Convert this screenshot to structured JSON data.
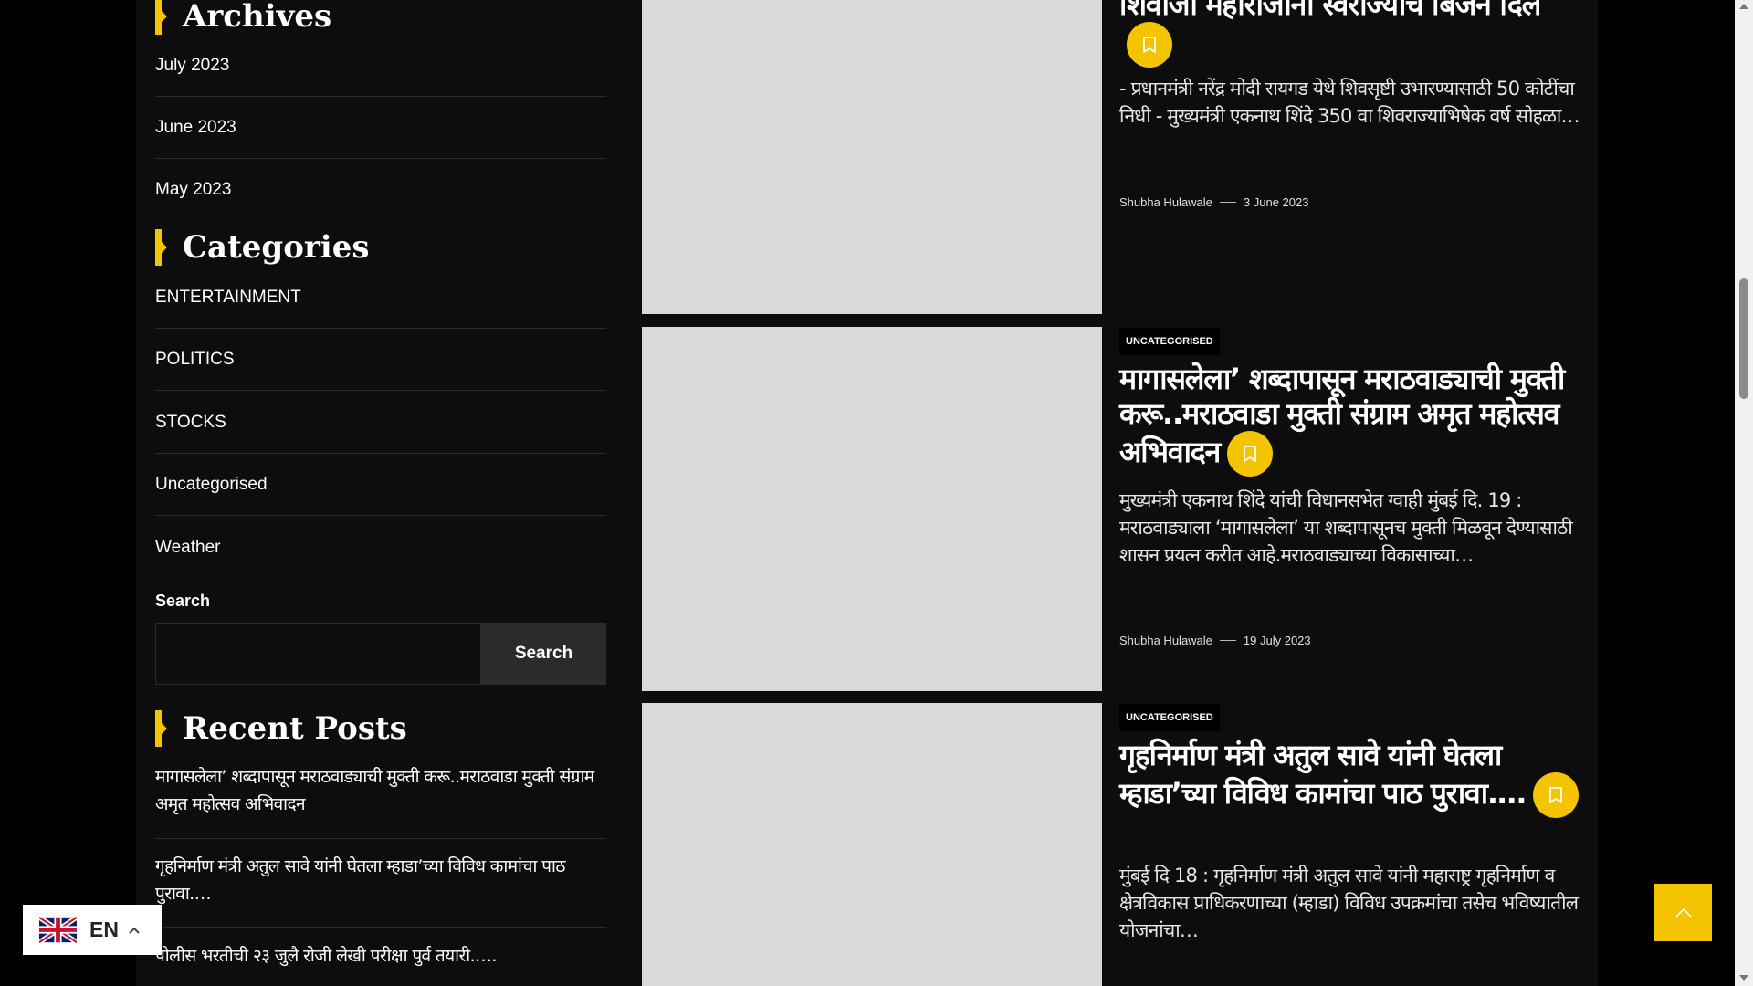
{
  "sidebar": {
    "archives": {
      "title": "Archives",
      "items": [
        "July 2023",
        "June 2023",
        "May 2023"
      ]
    },
    "categories": {
      "title": "Categories",
      "items": [
        "ENTERTAINMENT",
        "POLITICS",
        "STOCKS",
        "Uncategorised",
        "Weather"
      ]
    },
    "search": {
      "label": "Search",
      "placeholder": "",
      "button_label": "Search"
    },
    "recent_posts": {
      "title": "Recent Posts",
      "items": [
        "मागासलेला’ शब्दापासून मराठवाड्याची मुक्ती करू..मराठवाडा मुक्ती संग्राम अमृत महोत्सव अभिवादन",
        "गृहनिर्माण मंत्री अतुल सावे यांनी घेतला म्हाडा’च्या विविध कामांचा पाठ पुरावा.…",
        "पोलीस भरतीची २३ जुलै रोजी लेखी परीक्षा पुर्व तयारी.…."
      ]
    }
  },
  "posts": [
    {
      "category": "",
      "title": "शिवाजी महाराजांनी स्वराज्याचे बिजन दिले",
      "excerpt": "- प्रधानमंत्री नरेंद्र मोदी रायगड येथे शिवसृष्टी उभारण्यासाठी 50 कोटींचा निधी - मुख्यमंत्री एकनाथ शिंदे 350 वा शिवराज्याभिषेक वर्ष सोहळा…",
      "author": "Shubha Hulawale",
      "date": "3 June 2023"
    },
    {
      "category": "UNCATEGORISED",
      "title": "मागासलेला’ शब्दापासून मराठवाड्याची मुक्ती करू..मराठवाडा मुक्ती संग्राम अमृत महोत्सव अभिवादन",
      "excerpt": "मुख्यमंत्री एकनाथ शिंदे यांची विधानसभेत ग्वाही मुंबई दि. 19 : मराठवाड्याला ‘मागासलेला’ या शब्दापासूनच मुक्ती मिळवून देण्यासाठी शासन प्रयत्न करीत आहे.मराठवाड्याच्या विकासाच्या…",
      "author": "Shubha Hulawale",
      "date": "19 July 2023"
    },
    {
      "category": "UNCATEGORISED",
      "title": "गृहनिर्माण मंत्री अतुल सावे यांनी घेतला म्हाडा’च्या विविध कामांचा पाठ पुरावा.…",
      "excerpt": "मुंबई दि 18 : गृहनिर्माण मंत्री अतुल सावे यांनी महाराष्ट्र गृहनिर्माण व क्षेत्रविकास प्राधिकरणाच्या (म्हाडा) विविध उपक्रमांचा तसेच भविष्यातील योजनांचा…"
    }
  ],
  "language": {
    "code": "EN",
    "flag_icon": "uk-flag-icon"
  },
  "colors": {
    "accent": "#f5c400",
    "background": "#000000",
    "panel": "#0d0d0d",
    "image_placeholder": "#d9d9d9"
  }
}
